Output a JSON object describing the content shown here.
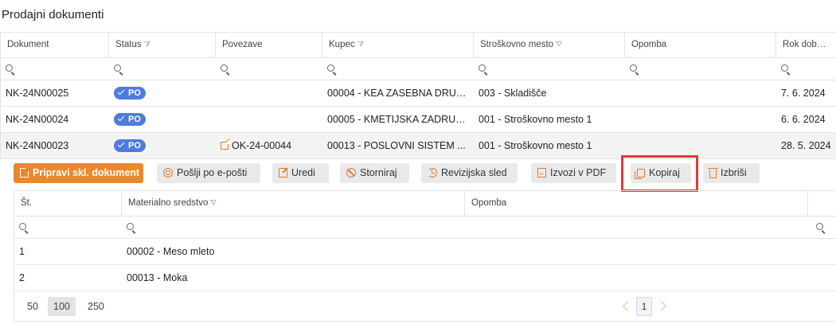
{
  "page": {
    "title": "Prodajni dokumenti"
  },
  "grid": {
    "columns": [
      "Dokument",
      "Status",
      "Povezave",
      "Kupec",
      "Stroškovno mesto",
      "Opomba",
      "Rok dobave"
    ],
    "rows": [
      {
        "dokument": "NK-24N00025",
        "status": "PO",
        "povezave": "",
        "kupec": "00004 - KEA ZASEBNA DRUŽ...",
        "strosek": "003 - Skladišče",
        "opomba": "",
        "rok": "7. 6. 2024"
      },
      {
        "dokument": "NK-24N00024",
        "status": "PO",
        "povezave": "",
        "kupec": "00005 - KMETIJSKA ZADRUG...",
        "strosek": "001 - Stroškovno mesto 1",
        "opomba": "",
        "rok": "6. 6. 2024"
      },
      {
        "dokument": "NK-24N00023",
        "status": "PO",
        "povezave": "OK-24-00044",
        "kupec": "00013 - POSLOVNI SISTEM ...",
        "strosek": "001 - Stroškovno mesto 1",
        "opomba": "",
        "rok": "28. 5. 2024"
      }
    ]
  },
  "toolbar": {
    "prepare": "Pripravi skl. dokument",
    "email": "Pošlji po e-pošti",
    "edit": "Uredi",
    "cancel": "Storniraj",
    "audit": "Revizijska sled",
    "pdf": "Izvozi v PDF",
    "copy": "Kopiraj",
    "delete": "Izbriši"
  },
  "subgrid": {
    "columns": [
      "Št.",
      "Materialno sredstvo",
      "Opomba"
    ],
    "rows": [
      {
        "st": "1",
        "material": "00002 - Meso mleto",
        "opomba": ""
      },
      {
        "st": "2",
        "material": "00013 - Moka",
        "opomba": ""
      }
    ]
  },
  "pager": {
    "sizes": [
      "50",
      "100",
      "250"
    ],
    "active_size": "100",
    "current_page": "1"
  },
  "colors": {
    "accent": "#e8892c",
    "badge": "#4f7cdc",
    "highlight": "#e53935"
  }
}
